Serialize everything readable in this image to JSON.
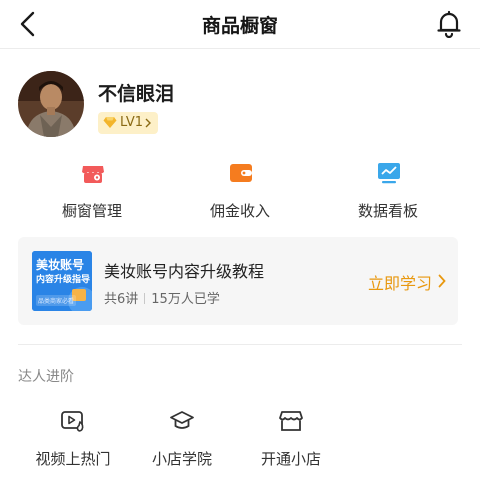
{
  "header": {
    "title": "商品橱窗",
    "back_icon": "chevron-left-icon",
    "bell_icon": "bell-icon"
  },
  "profile": {
    "name": "不信眼泪",
    "level": "LV1",
    "level_icon": "diamond-icon"
  },
  "quick_actions": [
    {
      "label": "橱窗管理",
      "icon": "shop-gear-icon",
      "color": "#f25a5a"
    },
    {
      "label": "佣金收入",
      "icon": "wallet-icon",
      "color": "#f57c1f"
    },
    {
      "label": "数据看板",
      "icon": "chart-board-icon",
      "color": "#3aa7ea"
    }
  ],
  "course": {
    "thumb_title": "美妆账号",
    "thumb_subtitle": "内容升级指导",
    "thumb_tag": "品类商家必看",
    "title": "美妆账号内容升级教程",
    "lessons": "共6讲",
    "learners": "15万人已学",
    "cta": "立即学习",
    "cta_color": "#e8980f"
  },
  "section": {
    "title": "达人进阶"
  },
  "tools": [
    {
      "label": "视频上热门",
      "icon": "video-fire-icon"
    },
    {
      "label": "小店学院",
      "icon": "graduation-cap-icon"
    },
    {
      "label": "开通小店",
      "icon": "store-icon"
    }
  ]
}
